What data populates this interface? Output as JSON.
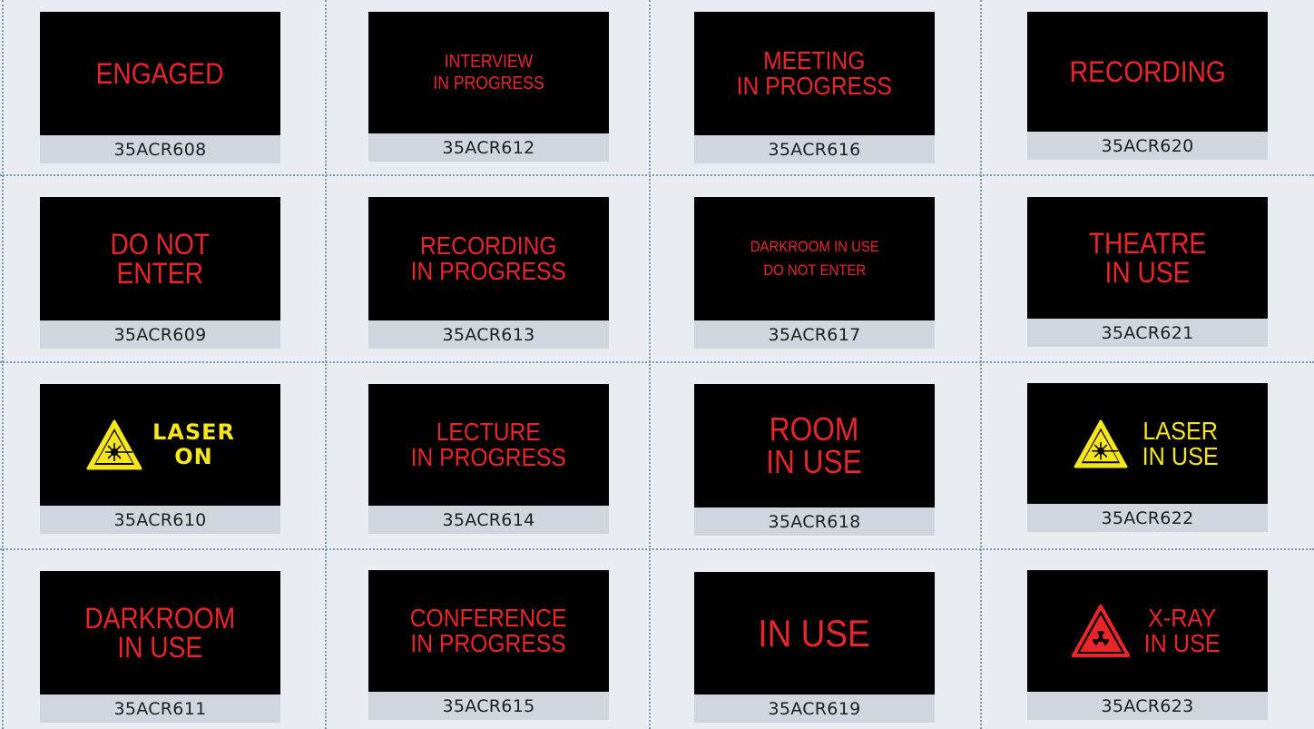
{
  "colors": {
    "background": "#e9ecf0",
    "sign_background": "#000000",
    "sign_text_red": "#e8262a",
    "sign_text_yellow": "#f5e51c",
    "code_bar": "#d1d6de",
    "divider": "#7f97ad"
  },
  "signs": [
    {
      "text": "ENGAGED",
      "code": "35ACR608"
    },
    {
      "text": "INTERVIEW\nIN PROGRESS",
      "code": "35ACR612"
    },
    {
      "text": "MEETING\nIN PROGRESS",
      "code": "35ACR616"
    },
    {
      "text": "RECORDING",
      "code": "35ACR620"
    },
    {
      "text": "DO NOT\nENTER",
      "code": "35ACR609"
    },
    {
      "text": "RECORDING\nIN PROGRESS",
      "code": "35ACR613"
    },
    {
      "text": "DARKROOM IN USE\nDO NOT ENTER",
      "code": "35ACR617"
    },
    {
      "text": "THEATRE\nIN USE",
      "code": "35ACR621"
    },
    {
      "text": "LASER\nON",
      "code": "35ACR610",
      "icon": "laser-warning-icon"
    },
    {
      "text": "LECTURE\nIN PROGRESS",
      "code": "35ACR614"
    },
    {
      "text": "ROOM\nIN USE",
      "code": "35ACR618"
    },
    {
      "text": "LASER\nIN USE",
      "code": "35ACR622",
      "icon": "laser-warning-icon"
    },
    {
      "text": "DARKROOM\nIN USE",
      "code": "35ACR611"
    },
    {
      "text": "CONFERENCE\nIN PROGRESS",
      "code": "35ACR615"
    },
    {
      "text": "IN USE",
      "code": "35ACR619"
    },
    {
      "text": "X-RAY\nIN USE",
      "code": "35ACR623",
      "icon": "radiation-warning-icon"
    }
  ]
}
